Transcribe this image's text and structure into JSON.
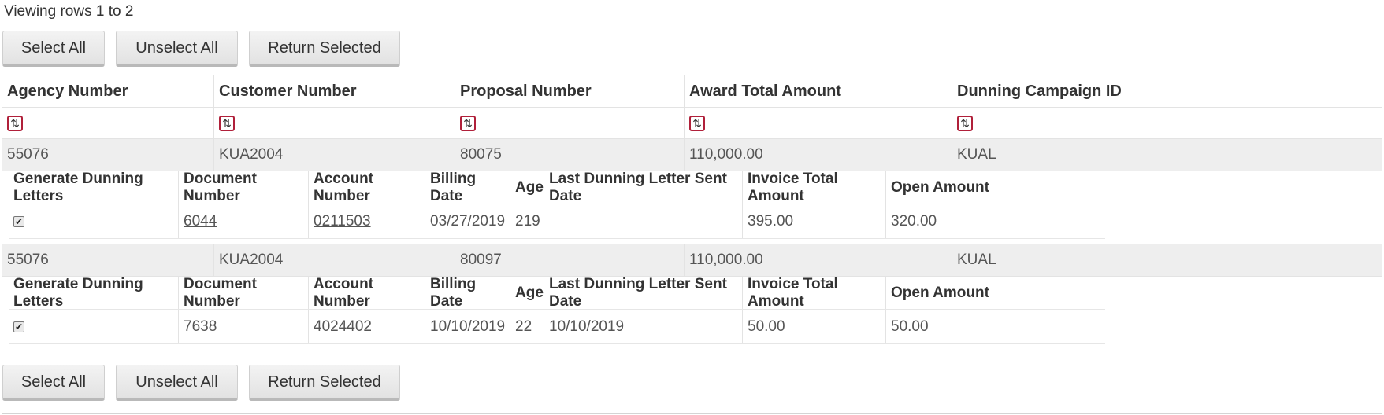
{
  "viewing_text": "Viewing rows 1 to 2",
  "buttons": {
    "select_all": "Select All",
    "unselect_all": "Unselect All",
    "return_selected": "Return Selected"
  },
  "outer_columns": [
    "Agency Number",
    "Customer Number",
    "Proposal Number",
    "Award Total Amount",
    "Dunning Campaign ID"
  ],
  "detail_columns": [
    "Generate Dunning Letters",
    "Document Number",
    "Account Number",
    "Billing Date",
    "Age",
    "Last Dunning Letter Sent Date",
    "Invoice Total Amount",
    "Open Amount"
  ],
  "sort_icon": "sort-arrows-icon",
  "colors": {
    "sort_icon_border": "#b0203a",
    "group_row_bg": "#eeeeee"
  },
  "rows": [
    {
      "agency_number": "55076",
      "customer_number": "KUA2004",
      "proposal_number": "80075",
      "award_total_amount": "110,000.00",
      "dunning_campaign_id": "KUAL",
      "detail": {
        "generate_checked": true,
        "document_number": "6044",
        "account_number": "0211503",
        "billing_date": "03/27/2019",
        "age": "219",
        "last_sent_date": "",
        "invoice_total_amount": "395.00",
        "open_amount": "320.00"
      }
    },
    {
      "agency_number": "55076",
      "customer_number": "KUA2004",
      "proposal_number": "80097",
      "award_total_amount": "110,000.00",
      "dunning_campaign_id": "KUAL",
      "detail": {
        "generate_checked": true,
        "document_number": "7638",
        "account_number": "4024402",
        "billing_date": "10/10/2019",
        "age": "22",
        "last_sent_date": "10/10/2019",
        "invoice_total_amount": "50.00",
        "open_amount": "50.00"
      }
    }
  ]
}
